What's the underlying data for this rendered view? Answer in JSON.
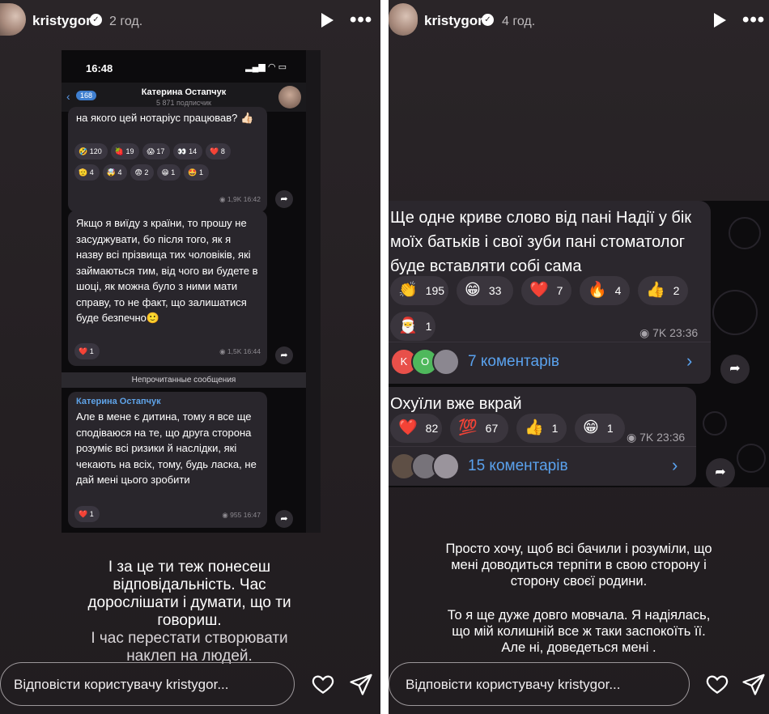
{
  "left_story": {
    "username": "kristygor",
    "time": "2 год.",
    "phone": {
      "status_time": "16:48",
      "status_icons": "▂▄▆ ◠ ▭",
      "back_count": "168",
      "channel_name": "Катерина Остапчук",
      "channel_subs": "5 871 подписчик",
      "msg1": {
        "text": "на якого цей нотаріус працював? 👍🏻",
        "reactions": [
          {
            "emoji": "🤣",
            "count": "120"
          },
          {
            "emoji": "🍓",
            "count": "19"
          },
          {
            "emoji": "😱",
            "count": "17"
          },
          {
            "emoji": "👀",
            "count": "14"
          },
          {
            "emoji": "❤️",
            "count": "8"
          },
          {
            "emoji": "🫡",
            "count": "4"
          },
          {
            "emoji": "🤯",
            "count": "4"
          },
          {
            "emoji": "😨",
            "count": "2"
          },
          {
            "emoji": "😁",
            "count": "1"
          },
          {
            "emoji": "🤩",
            "count": "1"
          }
        ],
        "meta": "◉ 1,9K 16:42"
      },
      "msg2": {
        "text": "Якщо я виїду з країни, то прошу не засуджувати, бо після того, як я назву всі прізвища тих чоловіків, які займаються тим, від чого ви будете в шоці, як можна було з ними мати справу, то не факт, що залишатися буде безпечно🙂",
        "reactions": [
          {
            "emoji": "❤️",
            "count": "1"
          }
        ],
        "meta": "◉ 1,5K 16:44"
      },
      "unread_label": "Непрочитанные сообщения",
      "msg3": {
        "author": "Катерина Остапчук",
        "text": "Але в мене є дитина, тому я все ще сподіваюся на те, що друга сторона розуміє всі ризики й наслідки, які чекають на всіх, тому, будь ласка, не дай мені цього зробити",
        "reactions": [
          {
            "emoji": "❤️",
            "count": "1"
          }
        ],
        "meta": "◉ 955 16:47"
      }
    },
    "caption_main": "І за це ти теж понесеш відповідальність. Час дорослішати і думати, що ти говориш.",
    "caption_secondary": "І час перестати створювати наклеп на людей.",
    "reply_placeholder": "Відповісти користувачу kristygor..."
  },
  "right_story": {
    "username": "kristygor",
    "time": "4 год.",
    "msg1": {
      "text": "Ще одне криве слово від пані Надії у бік моїх батьків і свої зуби пані стоматолог буде вставляти собі сама",
      "reactions": [
        {
          "emoji": "👏",
          "count": "195"
        },
        {
          "emoji": "😁",
          "count": "33"
        },
        {
          "emoji": "❤️",
          "count": "7"
        },
        {
          "emoji": "🔥",
          "count": "4"
        },
        {
          "emoji": "👍",
          "count": "2"
        },
        {
          "emoji": "🎅",
          "count": "1"
        }
      ],
      "meta": "◉ 7K 23:36",
      "avatar1": "K",
      "avatar2": "O",
      "comments": "7 коментарів"
    },
    "msg2": {
      "text": "Охуїли вже вкрай",
      "reactions": [
        {
          "emoji": "❤️",
          "count": "82"
        },
        {
          "emoji": "💯",
          "count": "67"
        },
        {
          "emoji": "👍",
          "count": "1"
        },
        {
          "emoji": "😁",
          "count": "1"
        }
      ],
      "meta": "◉ 7K 23:36",
      "comments": "15 коментарів"
    },
    "caption_main": "Просто хочу, щоб всі бачили і розуміли, що мені доводиться терпіти в свою сторону і сторону своєї родини.",
    "caption_secondary": "То я ще дуже довго мовчала. Я надіялась, що мій колишній все ж таки заспокоїть її. Але ні, доведеться мені .",
    "reply_placeholder": "Відповісти користувачу kristygor..."
  },
  "icons": {
    "verified": "verified-badge-icon",
    "play": "play-icon",
    "more": "more-options-icon",
    "heart": "heart-icon",
    "send": "send-icon",
    "share": "share-arrow-icon",
    "chevron": "chevron-right-icon"
  },
  "colors": {
    "story_bg": "#2a2528",
    "link_blue": "#5aa2ee",
    "bubble": "#2b272d"
  }
}
